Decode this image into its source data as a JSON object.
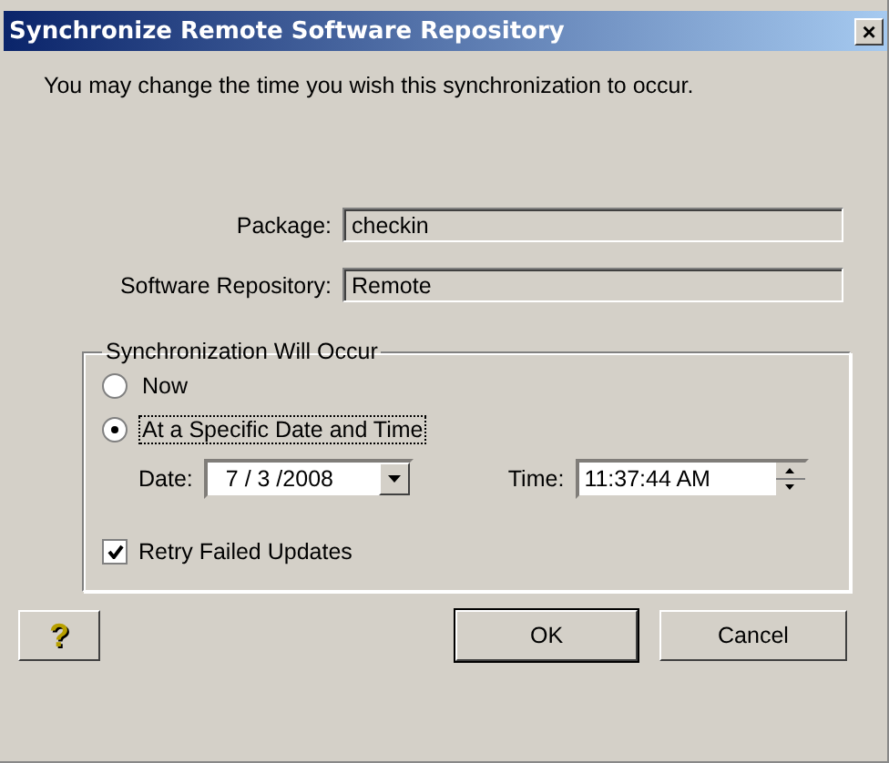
{
  "window": {
    "title": "Synchronize Remote Software Repository",
    "close": "×"
  },
  "intro": "You may change the time you wish this synchronization to occur.",
  "fields": [
    {
      "label": "Package:",
      "value": "checkin"
    },
    {
      "label": "Software Repository:",
      "value": "Remote"
    }
  ],
  "group": {
    "title": "Synchronization Will Occur",
    "options": [
      {
        "label": "Now",
        "selected": false
      },
      {
        "label": "At a Specific Date and Time",
        "selected": true
      }
    ],
    "date": {
      "label": "Date:",
      "value": "7 / 3 /2008"
    },
    "time": {
      "label": "Time:",
      "value": "11:37:44 AM"
    },
    "retry": {
      "label": "Retry Failed Updates",
      "checked": true
    }
  },
  "buttons": {
    "help": "?",
    "ok": "OK",
    "cancel": "Cancel"
  }
}
